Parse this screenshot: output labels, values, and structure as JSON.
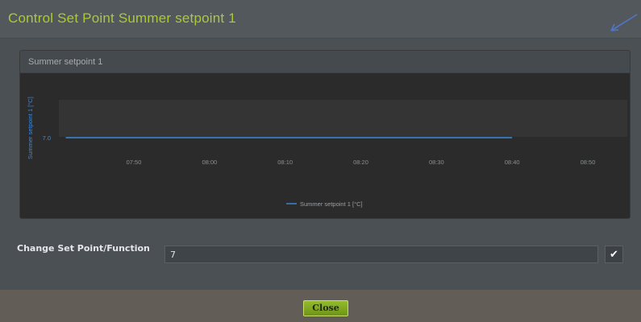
{
  "dialog": {
    "title": "Control Set Point Summer setpoint 1"
  },
  "panel": {
    "title": "Summer setpoint 1"
  },
  "chart_data": {
    "type": "line",
    "ylabel": "Summer setpoint 1 [°C]",
    "xlabel": "",
    "x_ticks": [
      "07:50",
      "08:00",
      "08:10",
      "08:20",
      "08:30",
      "08:40",
      "08:50"
    ],
    "y_ticks": [
      "7.0"
    ],
    "grid": false,
    "legend_position": "bottom-center",
    "series": [
      {
        "name": "Summer setpoint 1 [°C]",
        "color": "#3a8be0",
        "points": [
          {
            "x": "07:41",
            "y": 7.0
          },
          {
            "x": "08:40",
            "y": 7.0
          }
        ]
      }
    ]
  },
  "control": {
    "label": "Change Set Point/Function",
    "value": "7",
    "confirm_icon": "check-icon"
  },
  "footer": {
    "close_label": "Close"
  },
  "colors": {
    "title_accent": "#a9c93a",
    "series_line": "#3a8be0",
    "close_button": "#7fa523"
  }
}
